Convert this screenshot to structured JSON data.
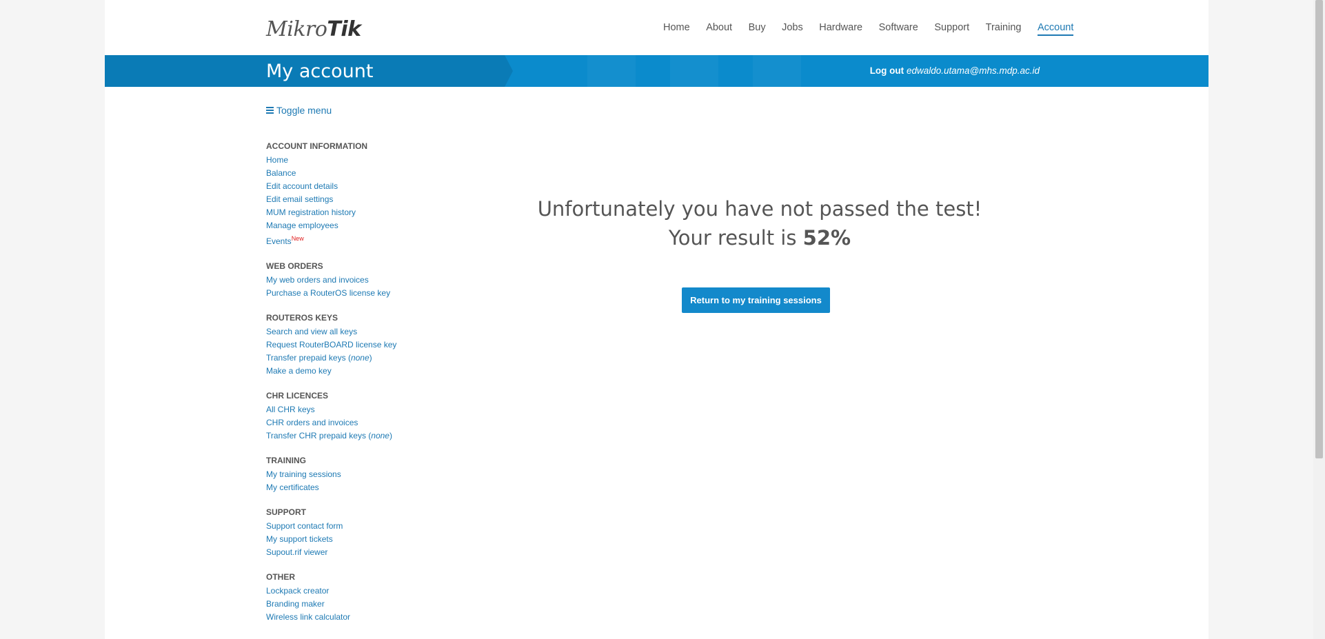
{
  "header": {
    "logo_left": "Mikro",
    "logo_right": "Tik",
    "nav": [
      "Home",
      "About",
      "Buy",
      "Jobs",
      "Hardware",
      "Software",
      "Support",
      "Training",
      "Account"
    ],
    "active_nav": "Account"
  },
  "banner": {
    "title": "My account",
    "logout_label": "Log out",
    "user_email": "edwaldo.utama@mhs.mdp.ac.id"
  },
  "sidebar": {
    "toggle_label": "Toggle menu",
    "sections": [
      {
        "heading": "ACCOUNT INFORMATION",
        "items": [
          "Home",
          "Balance",
          "Edit account details",
          "Edit email settings",
          "MUM registration history",
          "Manage employees",
          "Events"
        ]
      },
      {
        "heading": "WEB ORDERS",
        "items": [
          "My web orders and invoices",
          "Purchase a RouterOS license key"
        ]
      },
      {
        "heading": "ROUTEROS KEYS",
        "items": [
          "Search and view all keys",
          "Request RouterBOARD license key",
          "Transfer prepaid keys",
          "Make a demo key"
        ]
      },
      {
        "heading": "CHR LICENCES",
        "items": [
          "All CHR keys",
          "CHR orders and invoices",
          "Transfer CHR prepaid keys"
        ]
      },
      {
        "heading": "TRAINING",
        "items": [
          "My training sessions",
          "My certificates"
        ]
      },
      {
        "heading": "SUPPORT",
        "items": [
          "Support contact form",
          "My support tickets",
          "Supout.rif viewer"
        ]
      },
      {
        "heading": "OTHER",
        "items": [
          "Lockpack creator",
          "Branding maker",
          "Wireless link calculator"
        ]
      }
    ],
    "events_badge": "New",
    "none_note": "none"
  },
  "main": {
    "message": "Unfortunately you have not passed the test!",
    "result_prefix": "Your result is",
    "result_value": "52%",
    "return_button": "Return to my training sessions"
  },
  "colors": {
    "accent": "#1d79b3",
    "banner": "#0b8bcc",
    "button": "#1389cb"
  }
}
